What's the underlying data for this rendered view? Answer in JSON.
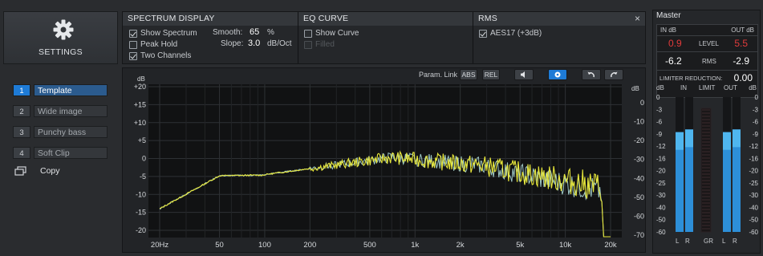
{
  "settings": {
    "label": "SETTINGS",
    "icon": "gear-icon"
  },
  "spectrum_display": {
    "header": "SPECTRUM DISPLAY",
    "show_spectrum": {
      "label": "Show Spectrum",
      "checked": true
    },
    "peak_hold": {
      "label": "Peak Hold",
      "checked": false
    },
    "two_channels": {
      "label": "Two Channels",
      "checked": true
    },
    "smooth": {
      "label": "Smooth:",
      "value": "65",
      "unit": "%"
    },
    "slope": {
      "label": "Slope:",
      "value": "3.0",
      "unit": "dB/Oct"
    }
  },
  "eq_curve": {
    "header": "EQ CURVE",
    "show_curve": {
      "label": "Show Curve",
      "checked": false
    },
    "filled": {
      "label": "Filled",
      "checked": false,
      "disabled": true
    }
  },
  "rms": {
    "header": "RMS",
    "aes17": {
      "label": "AES17 (+3dB)",
      "checked": true
    }
  },
  "close_label": "×",
  "presets": [
    {
      "num": "1",
      "name": "Template",
      "active": true
    },
    {
      "num": "2",
      "name": "Wide image",
      "active": false
    },
    {
      "num": "3",
      "name": "Punchy bass",
      "active": false
    },
    {
      "num": "4",
      "name": "Soft Clip",
      "active": false
    }
  ],
  "copy_label": "Copy",
  "toolbar": {
    "param_link_label": "Param. Link",
    "abs_label": "ABS",
    "rel_label": "REL"
  },
  "graph": {
    "left_unit": "dB",
    "right_unit": "dB",
    "left_ticks": [
      "+20",
      "+15",
      "+10",
      "+5",
      "0",
      "-5",
      "-10",
      "-15",
      "-20"
    ],
    "right_ticks": [
      "0",
      "-10",
      "-20",
      "-30",
      "-40",
      "-50",
      "-60",
      "-70"
    ],
    "freq_ticks": [
      "20Hz",
      "50",
      "100",
      "200",
      "500",
      "1k",
      "2k",
      "5k",
      "10k",
      "20k"
    ],
    "colors": {
      "series_a": "#e8e83a",
      "series_b": "#9ec7c4",
      "grid": "#3a3d41",
      "bg": "#101112"
    }
  },
  "master": {
    "title": "Master",
    "in_db_label": "IN dB",
    "out_db_label": "OUT dB",
    "level_label": "LEVEL",
    "rms_label": "RMS",
    "in_level": "0.9",
    "out_level": "5.5",
    "in_rms": "-6.2",
    "out_rms": "-2.9",
    "limiter_label": "LIMITER REDUCTION:",
    "limiter_value": "0.00",
    "meter_db_left": "dB",
    "meter_db_right": "dB",
    "in_header": "IN",
    "limit_header": "LIMIT",
    "out_header": "OUT",
    "scale": [
      "0",
      "-3",
      "-6",
      "-9",
      "-12",
      "-16",
      "-20",
      "-25",
      "-30",
      "-40",
      "-50",
      "-60"
    ],
    "ch_l": "L",
    "ch_r": "R",
    "gr_label": "GR",
    "ch_l2": "L",
    "ch_r2": "R",
    "meter_levels": {
      "in_l": 0.74,
      "in_r": 0.76,
      "out_l": 0.74,
      "out_r": 0.76
    },
    "colors": {
      "level_red": "#e23b3b",
      "meter_blue": "#2d8fd8"
    }
  }
}
